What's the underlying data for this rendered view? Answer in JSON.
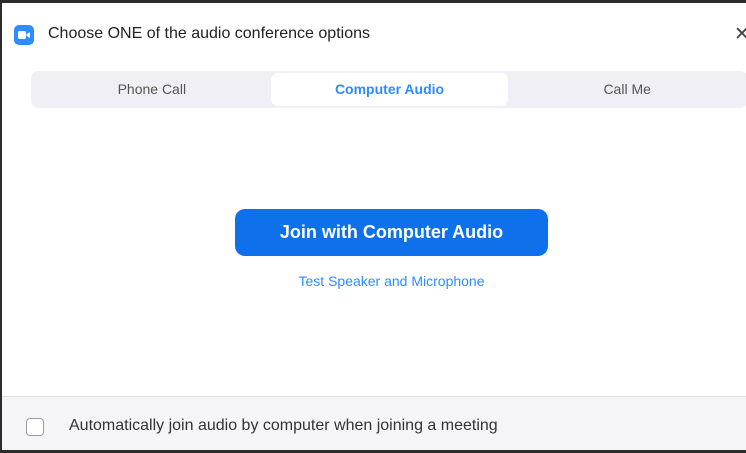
{
  "window": {
    "title": "Choose ONE of the audio conference options",
    "close_glyph": "✕",
    "app_icon": "zoom-camera-icon"
  },
  "tabs": [
    {
      "label": "Phone Call",
      "active": false
    },
    {
      "label": "Computer Audio",
      "active": true
    },
    {
      "label": "Call Me",
      "active": false
    }
  ],
  "main": {
    "join_button_label": "Join with Computer Audio",
    "test_link_label": "Test Speaker and Microphone"
  },
  "footer": {
    "auto_join_label": "Automatically join audio by computer when joining a meeting",
    "auto_join_checked": false
  },
  "colors": {
    "accent": "#2d8cff",
    "button_bg": "#0e71eb",
    "tab_bar_bg": "#efeff5"
  }
}
